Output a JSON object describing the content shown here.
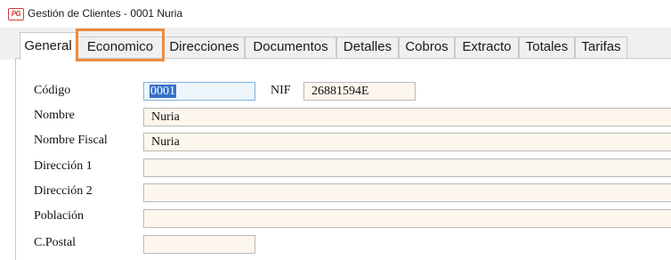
{
  "window": {
    "app_icon_text": "PG",
    "title": "Gestión de Clientes - 0001 Nuria"
  },
  "tabs": [
    {
      "label": "General",
      "active": true
    },
    {
      "label": "Economico",
      "active": false,
      "highlighted": true
    },
    {
      "label": "Direcciones",
      "active": false
    },
    {
      "label": "Documentos",
      "active": false
    },
    {
      "label": "Detalles",
      "active": false
    },
    {
      "label": "Cobros",
      "active": false
    },
    {
      "label": "Extracto",
      "active": false
    },
    {
      "label": "Totales",
      "active": false
    },
    {
      "label": "Tarifas",
      "active": false
    }
  ],
  "form": {
    "codigo": {
      "label": "Código",
      "value": "0001"
    },
    "nif": {
      "label": "NIF",
      "value": "26881594E"
    },
    "nombre": {
      "label": "Nombre",
      "value": "Nuria"
    },
    "nombre_fiscal": {
      "label": "Nombre Fiscal",
      "value": "Nuria"
    },
    "direccion1": {
      "label": "Dirección 1",
      "value": ""
    },
    "direccion2": {
      "label": "Dirección 2",
      "value": ""
    },
    "poblacion": {
      "label": "Población",
      "value": ""
    },
    "cpostal": {
      "label": "C.Postal",
      "value": ""
    }
  },
  "colors": {
    "highlight": "#ef8a3c",
    "field_bg": "#fdf6ec",
    "selection": "#3672c8"
  }
}
